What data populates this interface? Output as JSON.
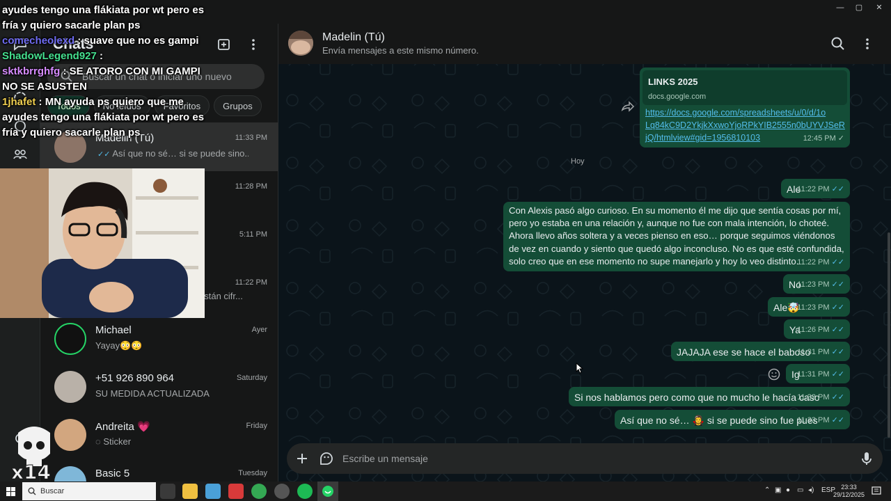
{
  "window": {
    "minimize": "—",
    "maximize": "▢",
    "close": "✕"
  },
  "sidebar": {
    "title": "Chats",
    "search_placeholder": "Buscar un chat o iniciar uno nuevo",
    "filters": [
      "Todos",
      "No leídos",
      "Favoritos",
      "Grupos"
    ],
    "chats": [
      {
        "name": "Madelin (Tú)",
        "preview": "Así que no sé… si se puede sino...",
        "time": "11:33 PM",
        "selected": true
      },
      {
        "name": "",
        "preview": "",
        "time": "11:28 PM"
      },
      {
        "name": "",
        "preview": "",
        "time": "5:11 PM"
      },
      {
        "name": "",
        "preview": "están cifr...",
        "time": "11:22 PM"
      },
      {
        "name": "Michael",
        "preview": "Yayay😳😳",
        "time": "Ayer"
      },
      {
        "name": "+51 926 890 964",
        "preview": "SU MEDIDA ACTUALIZADA",
        "time": "Saturday"
      },
      {
        "name": "Andreita 💗",
        "preview": "Sticker",
        "time": "Friday"
      },
      {
        "name": "Basic 5",
        "preview": "",
        "time": "Tuesday"
      }
    ]
  },
  "overlay": {
    "lines": [
      {
        "user": "",
        "text": "ayudes tengo una flákiata por wt pero es"
      },
      {
        "user": "",
        "text": "fría y quiero sacarle plan ps"
      },
      {
        "user": "comecheolexd",
        "user_color": "#6f6cf2",
        "text": ": suave que no es gampi"
      },
      {
        "user": "ShadowLegend927",
        "user_color": "#45e08f",
        "text": ":"
      },
      {
        "user": "sktkbrrghfg",
        "user_color": "#d78cff",
        "text": ": SE ATORO CON MI GAMPI"
      },
      {
        "user": "",
        "text": "NO SE ASUSTEN"
      },
      {
        "user": "1jhafet",
        "user_color": "#f0d050",
        "text": ": MN ayuda ps quiero que me"
      },
      {
        "user": "",
        "text": "ayudes tengo una flákiata por wt pero es"
      },
      {
        "user": "",
        "text": "fría y quiero sacarle plan ps"
      }
    ]
  },
  "chat": {
    "name": "Madelin (Tú)",
    "subtitle": "Envía mensajes a este mismo número.",
    "link_preview": {
      "title": "LINKS 2025",
      "domain": "docs.google.com",
      "url_lines": [
        "https://docs.google.com/spreadsheets/u/0/d/1o",
        "Lq84kC9D2YkjkXxwoYjoRPkYIB2555n0bUYVJSeR",
        "jQ/htmlview#gid=1956810103"
      ],
      "time": "12:45 PM"
    },
    "day_label": "Hoy",
    "messages": [
      {
        "text": "Ale",
        "time": "11:22 PM"
      },
      {
        "text": "Con Alexis pasó algo curioso. En su momento él me dijo que sentía cosas por mí, pero yo estaba en una relación y, aunque no fue con mala intención, lo choteé. Ahora llevo años soltera y a veces pienso en eso… porque seguimos viéndonos de vez en cuando y siento que quedó algo inconcluso. No es que esté confundida, solo creo que en ese momento no supe manejarlo y hoy lo veo distinto.",
        "time": "11:22 PM"
      },
      {
        "text": "No",
        "time": "11:23 PM"
      },
      {
        "text": "Ale🤯",
        "time": "11:23 PM"
      },
      {
        "text": "Ya",
        "time": "11:26 PM"
      },
      {
        "text": "JAJAJA ese se hace el baboso",
        "time": "11:31 PM"
      },
      {
        "text": "Ig",
        "time": "11:31 PM"
      },
      {
        "text": "Si nos hablamos pero como que no mucho le hacía caso",
        "time": "11:32 PM"
      },
      {
        "text": "Así que no sé… 🧛‍♀️ si se puede sino fue pues",
        "time": "11:33 PM"
      }
    ],
    "compose_placeholder": "Escribe un mensaje"
  },
  "taskbar": {
    "search_placeholder": "Buscar",
    "lang": "ESP",
    "time": "23:33",
    "date": "29/12/2025"
  },
  "colors": {
    "bubble_out": "#144d37",
    "read_tick": "#53bdeb",
    "link": "#53bdeb",
    "accent": "#00a884"
  }
}
